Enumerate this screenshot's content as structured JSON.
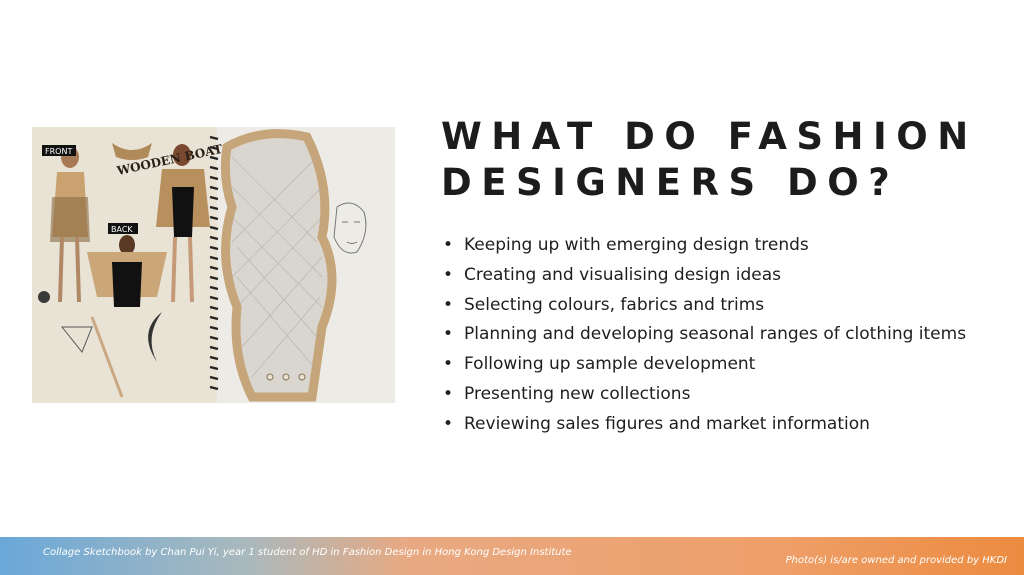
{
  "slide": {
    "title_line1": "WHAT DO FASHION",
    "title_line2": "DESIGNERS DO?",
    "bullets": [
      "Keeping up with emerging design trends",
      "Creating and visualising design ideas",
      "Selecting colours, fabrics and trims",
      "Planning and developing seasonal ranges of clothing items",
      "Following up sample development",
      "Presenting new collections",
      "Reviewing sales figures and market information"
    ],
    "bullet_glyph": "•"
  },
  "photo": {
    "sketch_labels": {
      "front": "FRONT",
      "wooden_boat": "WOODEN BOAT",
      "back": "BACK"
    }
  },
  "footer": {
    "caption": "Collage Sketchbook by Chan Pui Yi, year 1 student of HD in Fashion Design in Hong Kong Design Institute",
    "credit": "Photo(s) is/are owned and provided by HKDI"
  },
  "colors": {
    "title": "#1c1c1c",
    "body_text": "#1e1e1e",
    "footer_gradient": [
      "#6aa8d9",
      "#a9b9bd",
      "#e8a982",
      "#eea06a",
      "#ec8b40"
    ]
  }
}
